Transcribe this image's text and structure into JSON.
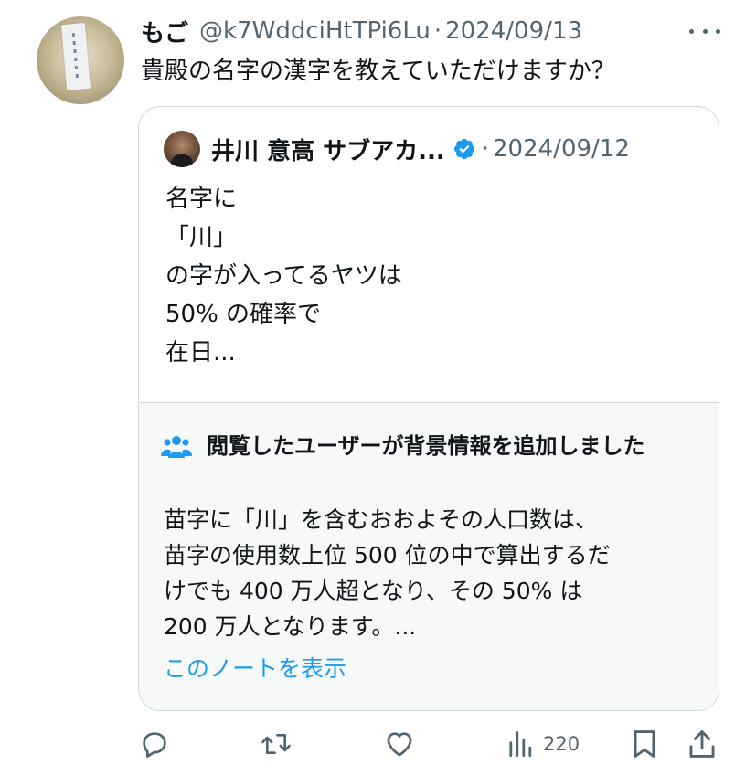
{
  "tweet": {
    "display_name": "もご",
    "handle": "@k7WddciHtTPi6Lu",
    "separator": "·",
    "date": "2024/09/13",
    "text": "貴殿の名字の漢字を教えていただけますか？"
  },
  "quote": {
    "display_name": "井川 意高 サブアカ...",
    "separator": "·",
    "date": "2024/09/12",
    "lines": [
      "名字に",
      "「川」",
      "の字が入ってるヤツは",
      "50% の確率で",
      "在日..."
    ]
  },
  "community_note": {
    "title": "閲覧したユーザーが背景情報を追加しました",
    "lines": [
      "苗字に「川」を含むおおよその人口数は、",
      "苗字の使用数上位 500 位の中で算出するだ",
      "けでも 400 万人超となり、その 50% は",
      "200 万人となります。..."
    ],
    "link_label": "このノートを表示"
  },
  "actions": {
    "views": "220"
  },
  "colors": {
    "text_primary": "#0f1419",
    "text_secondary": "#536471",
    "accent_blue": "#1d9bf0",
    "border": "#cfd9de",
    "note_background": "#f7f9f9"
  },
  "icons": {
    "reply": "speech-bubble-icon",
    "repost": "repost-arrows-icon",
    "like": "heart-icon",
    "views": "bar-chart-icon",
    "bookmark": "bookmark-icon",
    "share": "share-upload-icon",
    "more": "ellipsis-icon",
    "verified": "verified-badge-icon",
    "note": "people-icon"
  }
}
